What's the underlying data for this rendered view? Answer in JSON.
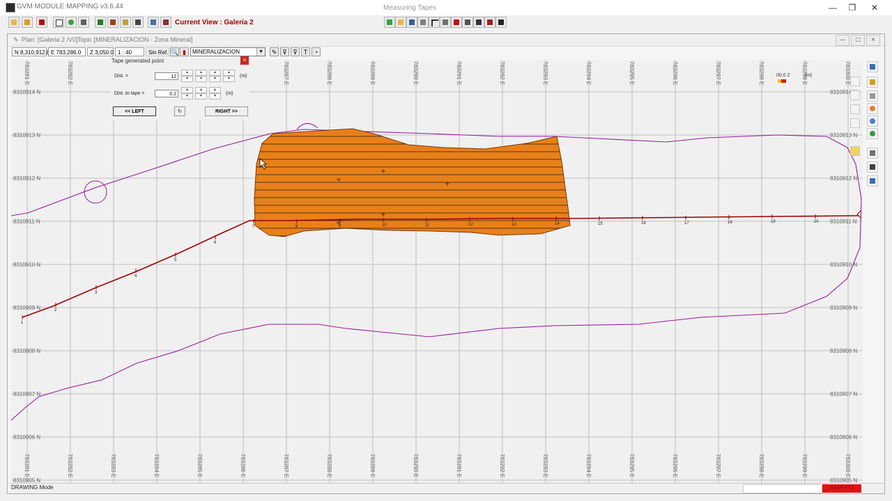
{
  "window": {
    "title": "GVM MODULE MAPPING v3.6.44",
    "subtitle": "Measuring Tapes",
    "controls": [
      "—",
      "❐",
      "✕"
    ]
  },
  "toolbar": {
    "current_view": "Current View : Galeria 2"
  },
  "child": {
    "plan_label": "Plan: [Galeria 2 /V0]",
    "topic_label": "Topic [MINERALIZACION - Zona Mineral]"
  },
  "status": {
    "north": "N 8,310,912.8",
    "east": "E 783,286.0",
    "z": "Z 3,050.0",
    "scale": "1 : 40",
    "ref": "Sin Ref.",
    "topic_value": "MINERALIZACION"
  },
  "tape_dialog": {
    "title": "Tape generated point",
    "dist_label": "Dist. =",
    "dist_value": "12",
    "dist_to_tape_label": "Dist. to tape =",
    "dist_to_tape_value": "0.2",
    "unit": "(m)",
    "left_button": "<< LEFT",
    "right_button": "RIGHT >>"
  },
  "map": {
    "east_labels": [
      "783281 E",
      "783282 E",
      "783283 E",
      "783284 E",
      "783285 E",
      "783286 E",
      "783287 E",
      "783288 E",
      "783289 E",
      "783290 E",
      "783291 E",
      "783292 E",
      "783293 E",
      "783294 E",
      "783295 E",
      "783296 E",
      "783297 E",
      "783298 E",
      "783299 E",
      "783300 E"
    ],
    "north_labels": [
      "8310914 N",
      "8310913 N",
      "8310912 N",
      "8310911 N",
      "8310910 N",
      "8310909 N",
      "8310908 N",
      "8310907 N",
      "8310906 N",
      "8310905 N"
    ],
    "tape_ticks": [
      "1",
      "2",
      "3",
      "4",
      "5",
      "6",
      "7",
      "8",
      "9",
      "10",
      "11",
      "12",
      "13",
      "14",
      "15",
      "16",
      "17",
      "18",
      "19",
      "20"
    ],
    "legend_value": "00.0 2",
    "legend_unit": "(m)",
    "colors": {
      "grid": "#b0b0b0",
      "ore": "#e8801a",
      "hatch": "#2a1a10",
      "tape": "#9a0000",
      "outline": "#9a1a9a"
    }
  },
  "statusbar": {
    "mode": "DRAWING Mode",
    "snap": "SNAP XYZ"
  }
}
